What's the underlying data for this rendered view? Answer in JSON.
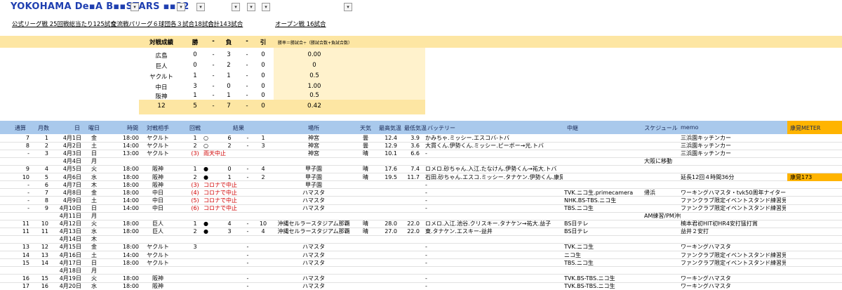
{
  "header": {
    "title": "YOKOHAMA De▪A B▪▪STARS ▪▪22",
    "info_season": "公式リーグ戦 25回戦総当たり125試合",
    "info_interleague": "交流戦パリーグ６球団各３試合18試合",
    "info_total": "合計143試合",
    "info_open": "オープン戦 16試合"
  },
  "dropdown_icon": "▾",
  "stats": {
    "title": "対戦成績",
    "col_win": "勝",
    "col_sep": "-",
    "col_loss": "負",
    "col_draw": "引",
    "formula": "勝率＝勝試合÷（勝試合数+負試合数）",
    "rows": [
      {
        "team": "広島",
        "w": "0",
        "d1": "-",
        "l": "3",
        "d2": "-",
        "t": "0",
        "pct": "0.00"
      },
      {
        "team": "巨人",
        "w": "0",
        "d1": "-",
        "l": "2",
        "d2": "-",
        "t": "0",
        "pct": "0"
      },
      {
        "team": "ヤクルト",
        "w": "1",
        "d1": "-",
        "l": "1",
        "d2": "-",
        "t": "0",
        "pct": "0.5"
      },
      {
        "team": "中日",
        "w": "3",
        "d1": "-",
        "l": "0",
        "d2": "-",
        "t": "0",
        "pct": "1.00"
      },
      {
        "team": "阪神",
        "w": "1",
        "d1": "-",
        "l": "1",
        "d2": "-",
        "t": "0",
        "pct": "0.5"
      }
    ],
    "total": {
      "team": "12",
      "w": "5",
      "d1": "-",
      "l": "7",
      "d2": "-",
      "t": "0",
      "pct": "0.42"
    }
  },
  "columns": {
    "tsusan": "通算",
    "month": "月数",
    "day": "日",
    "weekday": "曜日",
    "time": "時間",
    "opponent": "対戦相手",
    "round": "回戦",
    "result": "結果",
    "venue": "場所",
    "weather": "天気",
    "hi": "最高気温",
    "lo": "最低気温",
    "battery": "バッテリー",
    "broadcast": "中継",
    "schedule": "スケジュール",
    "memo": "memo",
    "meter": "康晃METER"
  },
  "rows": [
    {
      "n": "7",
      "m": "1",
      "d": "4月1日",
      "w": "金",
      "t": "18:00",
      "o": "ヤクルト",
      "rd": "1",
      "r1": "○",
      "r2": "6",
      "r3": "-",
      "r4": "1",
      "v": "神宮",
      "wx": "曇",
      "hi": "12.4",
      "lo": "3.9",
      "b": "かみちゃ.ミッシー.エスコバ-トバ",
      "tv": "",
      "sch": "",
      "memo": "三浜園キッチンカー",
      "mt": ""
    },
    {
      "n": "8",
      "m": "2",
      "d": "4月2日",
      "w": "土",
      "t": "14:00",
      "o": "ヤクルト",
      "rd": "2",
      "r1": "○",
      "r2": "2",
      "r3": "-",
      "r4": "3",
      "v": "神宮",
      "wx": "曇",
      "hi": "12.9",
      "lo": "3.6",
      "b": "大貫くん.伊勢くん.ミッシー.ピーボー→光.トバ",
      "tv": "",
      "sch": "",
      "memo": "三浜園キッチンカー",
      "mt": ""
    },
    {
      "n": "-",
      "m": "3",
      "d": "4月3日",
      "w": "日",
      "t": "13:00",
      "o": "ヤクルト",
      "rd": "(3)",
      "r1": "雨天中止",
      "r2": "",
      "r3": "",
      "r4": "",
      "v": "神宮",
      "wx": "晴",
      "hi": "10.1",
      "lo": "6.6",
      "b": "-",
      "tv": "",
      "sch": "",
      "memo": "三浜園キッチンカー",
      "mt": "",
      "red": true
    },
    {
      "n": "",
      "m": "",
      "d": "4月4日",
      "w": "月",
      "t": "",
      "o": "",
      "rd": "",
      "r1": "",
      "r2": "",
      "r3": "",
      "r4": "",
      "v": "",
      "wx": "",
      "hi": "",
      "lo": "",
      "b": "",
      "tv": "",
      "sch": "大阪に移動",
      "memo": "",
      "mt": ""
    },
    {
      "n": "9",
      "m": "4",
      "d": "4月5日",
      "w": "火",
      "t": "18:00",
      "o": "阪神",
      "rd": "1",
      "r1": "●",
      "r2": "0",
      "r3": "-",
      "r4": "4",
      "v": "甲子園",
      "wx": "晴",
      "hi": "17.6",
      "lo": "7.4",
      "b": "ロメロ.砂ちゃん.入江.たなけん.伊勢くん→祐大.トバ",
      "tv": "",
      "sch": "",
      "memo": "",
      "mt": ""
    },
    {
      "n": "10",
      "m": "5",
      "d": "4月6日",
      "w": "水",
      "t": "18:00",
      "o": "阪神",
      "rd": "2",
      "r1": "●",
      "r2": "1",
      "r3": "-",
      "r4": "2",
      "v": "甲子園",
      "wx": "晴",
      "hi": "19.5",
      "lo": "11.7",
      "b": "石田.砂ちゃん.エスコ.ミッシー.タナケン.伊勢くん.康晃-トバ",
      "tv": "",
      "sch": "",
      "memo": "延長12回４時間36分",
      "mt": "康晃173"
    },
    {
      "n": "-",
      "m": "6",
      "d": "4月7日",
      "w": "木",
      "t": "18:00",
      "o": "阪神",
      "rd": "(3)",
      "r1": "コロナで中止",
      "r2": "",
      "r3": "",
      "r4": "",
      "v": "甲子園",
      "wx": "",
      "hi": "",
      "lo": "",
      "b": "-",
      "tv": "",
      "sch": "",
      "memo": "",
      "mt": "",
      "red": true
    },
    {
      "n": "-",
      "m": "7",
      "d": "4月8日",
      "w": "金",
      "t": "18:00",
      "o": "中日",
      "rd": "(4)",
      "r1": "コロナで中止",
      "r2": "",
      "r3": "",
      "r4": "",
      "v": "ハマスタ",
      "wx": "",
      "hi": "",
      "lo": "",
      "b": "-",
      "tv": "TVK.ニコ生.primecamera",
      "sch": "帰浜",
      "memo": "ワーキングハマスタ・tvk50周年ナイター",
      "mt": "",
      "red": true
    },
    {
      "n": "-",
      "m": "8",
      "d": "4月9日",
      "w": "土",
      "t": "14:00",
      "o": "中日",
      "rd": "(5)",
      "r1": "コロナで中止",
      "r2": "",
      "r3": "",
      "r4": "",
      "v": "ハマスタ",
      "wx": "",
      "hi": "",
      "lo": "",
      "b": "-",
      "tv": "NHK.BS-TBS.ニコ生",
      "sch": "",
      "memo": "ファンクラブ限定イベントスタンド練習見学",
      "mt": "",
      "red": true
    },
    {
      "n": "-",
      "m": "9",
      "d": "4月10日",
      "w": "日",
      "t": "14:00",
      "o": "中日",
      "rd": "(6)",
      "r1": "コロナで中止",
      "r2": "",
      "r3": "",
      "r4": "",
      "v": "ハマスタ",
      "wx": "",
      "hi": "",
      "lo": "",
      "b": "-",
      "tv": "TBS.ニコ生",
      "sch": "",
      "memo": "ファンクラブ限定イベントスタンド練習見学・10日オースティン右肘手術の",
      "mt": "",
      "red": true
    },
    {
      "n": "",
      "m": "",
      "d": "4月11日",
      "w": "月",
      "t": "",
      "o": "",
      "rd": "",
      "r1": "",
      "r2": "",
      "r3": "",
      "r4": "",
      "v": "",
      "wx": "",
      "hi": "",
      "lo": "",
      "b": "",
      "tv": "",
      "sch": "AM練習/PM沖縄に移動",
      "memo": "",
      "mt": ""
    },
    {
      "n": "11",
      "m": "10",
      "d": "4月12日",
      "w": "火",
      "t": "18:00",
      "o": "巨人",
      "rd": "1",
      "r1": "●",
      "r2": "4",
      "r3": "-",
      "r4": "10",
      "v": "沖縄セルラースタジアム那覇",
      "wx": "晴",
      "hi": "28.0",
      "lo": "22.0",
      "b": "ロメロ.入江.池谷.クリスキー.タナケン→祐大.益子",
      "tv": "BS日テレ",
      "sch": "",
      "memo": "楠本君初HIT初HR4安打猛打賞",
      "mt": ""
    },
    {
      "n": "11",
      "m": "11",
      "d": "4月13日",
      "w": "水",
      "t": "18:00",
      "o": "巨人",
      "rd": "2",
      "r1": "●",
      "r2": "3",
      "r3": "-",
      "r4": "4",
      "v": "沖縄セルラースタジアム那覇",
      "wx": "晴",
      "hi": "27.0",
      "lo": "22.0",
      "b": "東.タナケン.エスキー-益井",
      "tv": "BS日テレ",
      "sch": "",
      "memo": "益井２安打",
      "mt": ""
    },
    {
      "n": "",
      "m": "",
      "d": "4月14日",
      "w": "木",
      "t": "",
      "o": "",
      "rd": "",
      "r1": "",
      "r2": "",
      "r3": "",
      "r4": "",
      "v": "",
      "wx": "",
      "hi": "",
      "lo": "",
      "b": "",
      "tv": "",
      "sch": "",
      "memo": "",
      "mt": ""
    },
    {
      "n": "13",
      "m": "12",
      "d": "4月15日",
      "w": "金",
      "t": "18:00",
      "o": "ヤクルト",
      "rd": "3",
      "r1": "",
      "r2": "",
      "r3": "-",
      "r4": "",
      "v": "ハマスタ",
      "wx": "",
      "hi": "",
      "lo": "",
      "b": "-",
      "tv": "TVK.ニコ生",
      "sch": "",
      "memo": "ワーキングハマスタ",
      "mt": ""
    },
    {
      "n": "14",
      "m": "13",
      "d": "4月16日",
      "w": "土",
      "t": "14:00",
      "o": "ヤクルト",
      "rd": "",
      "r1": "",
      "r2": "",
      "r3": "-",
      "r4": "",
      "v": "ハマスタ",
      "wx": "",
      "hi": "",
      "lo": "",
      "b": "-",
      "tv": "ニコ生",
      "sch": "",
      "memo": "ファンクラブ限定イベントスタンド練習見学・sportsLABベイスターズデ",
      "mt": ""
    },
    {
      "n": "15",
      "m": "14",
      "d": "4月17日",
      "w": "日",
      "t": "18:00",
      "o": "ヤクルト",
      "rd": "",
      "r1": "",
      "r2": "",
      "r3": "-",
      "r4": "",
      "v": "ハマスタ",
      "wx": "",
      "hi": "",
      "lo": "",
      "b": "-",
      "tv": "TBS.ニコ生",
      "sch": "",
      "memo": "ファンクラブ限定イベントスタンド練習見学",
      "mt": ""
    },
    {
      "n": "",
      "m": "",
      "d": "4月18日",
      "w": "月",
      "t": "",
      "o": "",
      "rd": "",
      "r1": "",
      "r2": "",
      "r3": "",
      "r4": "",
      "v": "",
      "wx": "",
      "hi": "",
      "lo": "",
      "b": "",
      "tv": "",
      "sch": "",
      "memo": "",
      "mt": ""
    },
    {
      "n": "16",
      "m": "15",
      "d": "4月19日",
      "w": "火",
      "t": "18:00",
      "o": "阪神",
      "rd": "",
      "r1": "",
      "r2": "",
      "r3": "-",
      "r4": "",
      "v": "ハマスタ",
      "wx": "",
      "hi": "",
      "lo": "",
      "b": "-",
      "tv": "TVK.BS-TBS.ニコ生",
      "sch": "",
      "memo": "ワーキングハマスタ",
      "mt": ""
    },
    {
      "n": "17",
      "m": "16",
      "d": "4月20日",
      "w": "水",
      "t": "18:00",
      "o": "阪神",
      "rd": "",
      "r1": "",
      "r2": "",
      "r3": "-",
      "r4": "",
      "v": "ハマスタ",
      "wx": "",
      "hi": "",
      "lo": "",
      "b": "-",
      "tv": "TVK.BS-TBS.ニコ生",
      "sch": "",
      "memo": "ワーキングハマスタ",
      "mt": ""
    }
  ]
}
